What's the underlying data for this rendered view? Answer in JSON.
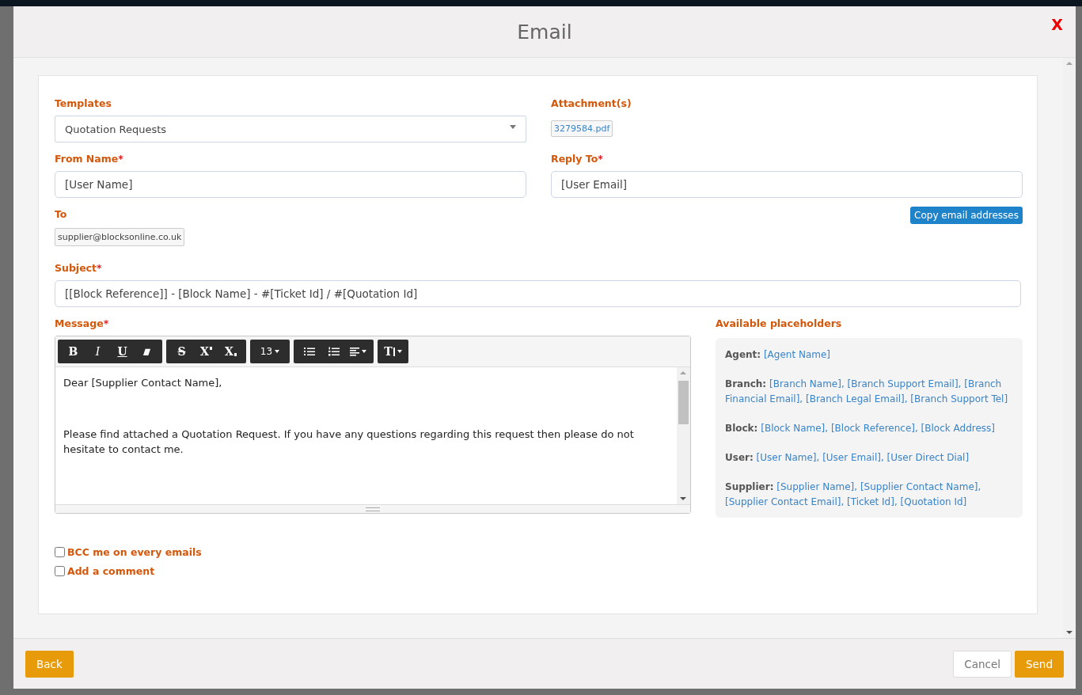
{
  "modal": {
    "title": "Email",
    "close": "X"
  },
  "templates": {
    "label": "Templates",
    "value": "Quotation Requests"
  },
  "attachments": {
    "label": "Attachment(s)",
    "files": [
      "3279584.pdf"
    ]
  },
  "from_name": {
    "label": "From Name",
    "required_mark": "*",
    "value": "[User Name]"
  },
  "reply_to": {
    "label": "Reply To",
    "required_mark": "*",
    "value": "[User Email]"
  },
  "copy_button": "Copy email addresses",
  "to": {
    "label": "To",
    "recipients": [
      "supplier@blocksonline.co.uk"
    ]
  },
  "subject": {
    "label": "Subject",
    "required_mark": "*",
    "value": "[[Block Reference]] - [Block Name] - #[Ticket Id] / #[Quotation Id]"
  },
  "message": {
    "label": "Message",
    "required_mark": "*",
    "toolbar": [
      [
        {
          "kind": "bold",
          "glyph": "B"
        },
        {
          "kind": "italic",
          "glyph": "I"
        },
        {
          "kind": "underline",
          "glyph": "U"
        },
        {
          "kind": "eraser"
        }
      ],
      [
        {
          "kind": "strike",
          "glyph": "S"
        },
        {
          "kind": "superscript",
          "glyph": "X"
        },
        {
          "kind": "subscript",
          "glyph": "X"
        }
      ],
      [
        {
          "kind": "fontsize",
          "glyph": "13"
        }
      ],
      [
        {
          "kind": "bullets"
        },
        {
          "kind": "numbers"
        },
        {
          "kind": "align"
        }
      ],
      [
        {
          "kind": "lineheight",
          "glyph": "T"
        }
      ]
    ],
    "paragraphs": [
      "Dear [Supplier Contact Name],",
      "Please find attached a Quotation Request. If you have any questions regarding this request then please do not hesitate to contact me."
    ]
  },
  "placeholders": {
    "title": "Available placeholders",
    "groups": [
      {
        "label": "Agent:",
        "items": "[Agent Name]"
      },
      {
        "label": "Branch:",
        "items": "[Branch Name], [Branch Support Email], [Branch Financial Email], [Branch Legal Email], [Branch Support Tel]"
      },
      {
        "label": "Block:",
        "items": "[Block Name], [Block Reference], [Block Address]"
      },
      {
        "label": "User:",
        "items": "[User Name], [User Email], [User Direct Dial]"
      },
      {
        "label": "Supplier:",
        "items": "[Supplier Name], [Supplier Contact Name], [Supplier Contact Email], [Ticket Id], [Quotation Id]"
      }
    ]
  },
  "options": [
    {
      "label": "BCC me on every emails",
      "checked": false
    },
    {
      "label": "Add a comment",
      "checked": false
    }
  ],
  "footer": {
    "back": "Back",
    "cancel": "Cancel",
    "send": "Send"
  }
}
